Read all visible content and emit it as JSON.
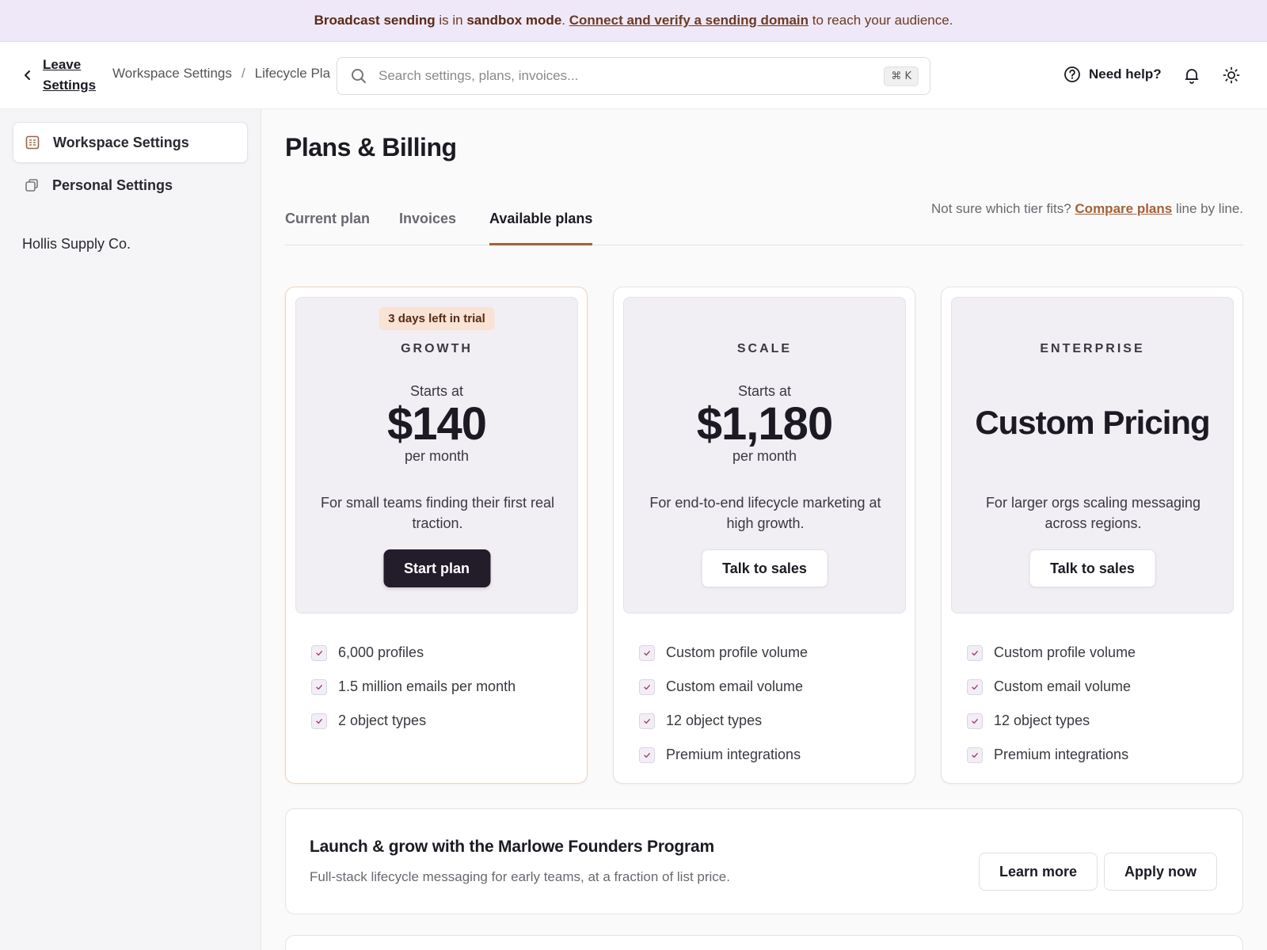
{
  "banner": {
    "part1": "Broadcast sending",
    "part2": " is in ",
    "part3": "sandbox mode",
    "part4": ". ",
    "link": "Connect and verify a sending domain",
    "part5": " to reach your audience."
  },
  "header": {
    "leave_label": "Leave Settings",
    "breadcrumbs": [
      "Workspace Settings",
      "Lifecycle Pla"
    ],
    "breadcrumb_sep": "/",
    "search_placeholder": "Search settings, plans, invoices...",
    "search_shortcut": "⌘ K",
    "help_label": "Need help?"
  },
  "sidebar": {
    "items": [
      {
        "label": "Workspace Settings",
        "active": true
      },
      {
        "label": "Personal Settings",
        "active": false
      }
    ],
    "org_name": "Hollis Supply Co."
  },
  "main": {
    "title": "Plans & Billing",
    "tabs": [
      {
        "label": "Current plan",
        "active": false
      },
      {
        "label": "Invoices",
        "active": false
      },
      {
        "label": "Available plans",
        "active": true
      }
    ],
    "compare": {
      "prefix": "Not sure which tier fits? ",
      "link": "Compare plans",
      "suffix": " line by line."
    },
    "plans": [
      {
        "badge": "3 days left in trial",
        "tier": "GROWTH",
        "starts": "Starts at",
        "price": "$140",
        "per": "per month",
        "description": "For small teams finding their first real traction.",
        "cta": "Start plan",
        "features": [
          "6,000 profiles",
          "1.5 million emails per month",
          "2 object types"
        ]
      },
      {
        "tier": "SCALE",
        "starts": "Starts at",
        "price": "$1,180",
        "per": "per month",
        "description": "For end-to-end lifecycle marketing at high growth.",
        "cta": "Talk to sales",
        "features": [
          "Custom profile volume",
          "Custom email volume",
          "12 object types",
          "Premium integrations"
        ]
      },
      {
        "tier": "ENTERPRISE",
        "price": "Custom Pricing",
        "description": "For larger orgs scaling messaging across regions.",
        "cta": "Talk to sales",
        "features": [
          "Custom profile volume",
          "Custom email volume",
          "12 object types",
          "Premium integrations"
        ]
      }
    ],
    "founders": {
      "title": "Launch & grow with the Marlowe Founders Program",
      "subtitle": "Full-stack lifecycle messaging for early teams, at a fraction of list price.",
      "learn_more": "Learn more",
      "apply_now": "Apply now"
    }
  },
  "colors": {
    "accent": "#a85f35",
    "banner_bg": "#efe8f8",
    "dark_button": "#221c2b"
  }
}
